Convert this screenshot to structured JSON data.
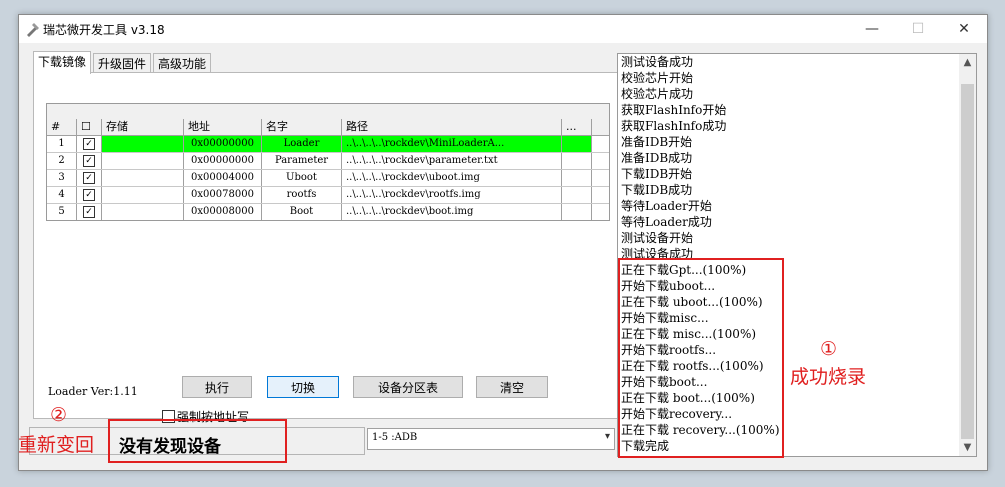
{
  "window": {
    "title": "瑞芯微开发工具 v3.18",
    "minimize": "—",
    "maximize": "☐",
    "close": "✕"
  },
  "tabs": [
    {
      "label": "下载镜像",
      "active": true
    },
    {
      "label": "升级固件",
      "active": false
    },
    {
      "label": "高级功能",
      "active": false
    }
  ],
  "table": {
    "headers": {
      "num": "#",
      "check": "☐",
      "storage": "存储",
      "address": "地址",
      "name": "名字",
      "path": "路径",
      "more": "..."
    },
    "rows": [
      {
        "num": "1",
        "checked": "✓",
        "storage": "",
        "address": "0x00000000",
        "name": "Loader",
        "path": "..\\..\\..\\..\\rockdev\\MiniLoaderA...",
        "selected": true
      },
      {
        "num": "2",
        "checked": "✓",
        "storage": "",
        "address": "0x00000000",
        "name": "Parameter",
        "path": "..\\..\\..\\..\\rockdev\\parameter.txt",
        "selected": false
      },
      {
        "num": "3",
        "checked": "✓",
        "storage": "",
        "address": "0x00004000",
        "name": "Uboot",
        "path": "..\\..\\..\\..\\rockdev\\uboot.img",
        "selected": false
      },
      {
        "num": "4",
        "checked": "✓",
        "storage": "",
        "address": "0x00078000",
        "name": "rootfs",
        "path": "..\\..\\..\\..\\rockdev\\rootfs.img",
        "selected": false
      },
      {
        "num": "5",
        "checked": "✓",
        "storage": "",
        "address": "0x00008000",
        "name": "Boot",
        "path": "..\\..\\..\\..\\rockdev\\boot.img",
        "selected": false
      }
    ]
  },
  "loader_version": "Loader Ver:1.11",
  "buttons": {
    "execute": "执行",
    "switch": "切换",
    "partition": "设备分区表",
    "clear": "清空"
  },
  "force_address_label": "强制按地址写",
  "status_text": "没有发现设备",
  "combo_value": "1-5 :ADB",
  "log_lines": [
    "测试设备成功",
    "校验芯片开始",
    "校验芯片成功",
    "获取FlashInfo开始",
    "获取FlashInfo成功",
    "准备IDB开始",
    "准备IDB成功",
    "下载IDB开始",
    "下载IDB成功",
    "等待Loader开始",
    "等待Loader成功",
    "测试设备开始",
    "测试设备成功",
    "正在下载Gpt...(100%)",
    "开始下载uboot...",
    "正在下载 uboot...(100%)",
    "开始下载misc...",
    "正在下载 misc...(100%)",
    "开始下载rootfs...",
    "正在下载 rootfs...(100%)",
    "开始下载boot...",
    "正在下载 boot...(100%)",
    "开始下载recovery...",
    "正在下载 recovery...(100%)",
    "下载完成"
  ],
  "annotations": {
    "success_marker": "①",
    "success_label": "成功烧录",
    "switch_marker": "②",
    "switch_label": "重新变回"
  },
  "colors": {
    "selected_row": "#00ff00",
    "annotation": "#e02020"
  }
}
